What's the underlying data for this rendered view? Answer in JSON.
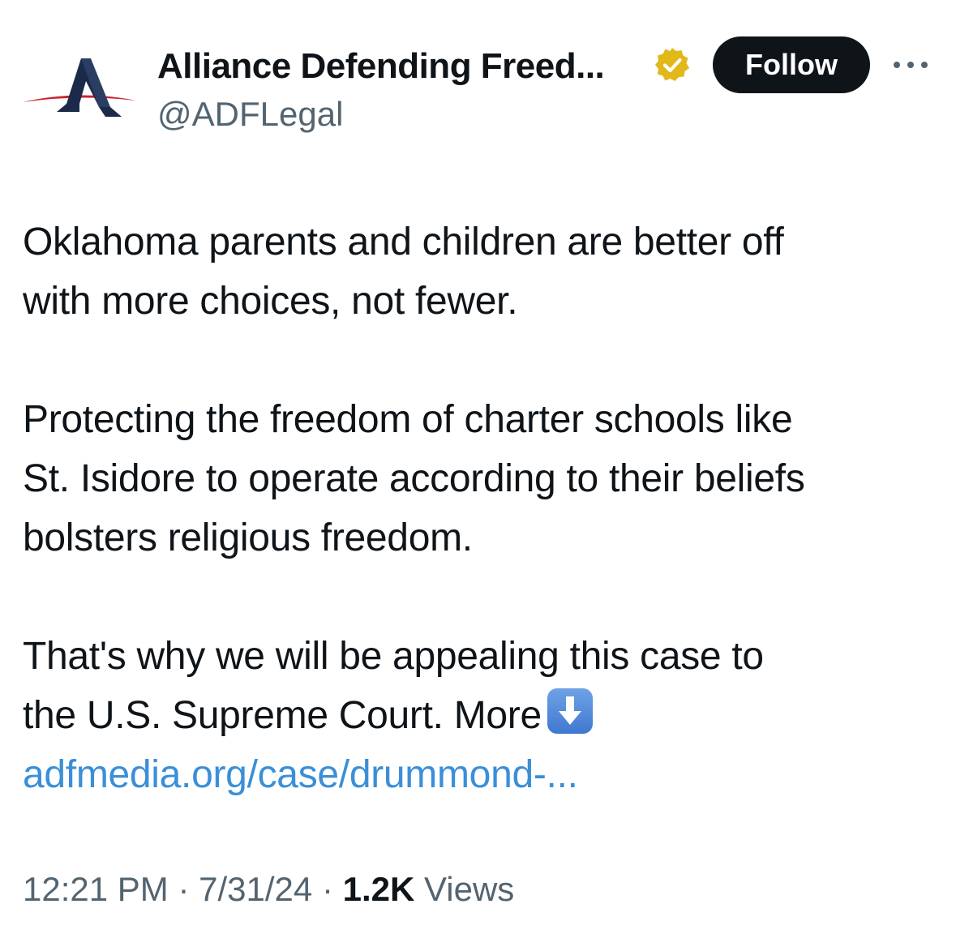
{
  "author": {
    "name": "Alliance Defending Freed...",
    "handle": "@ADFLegal",
    "avatar_icon": "adf-logo-icon",
    "verified_icon": "gold-verified-badge-icon"
  },
  "actions": {
    "follow_label": "Follow",
    "more_icon": "more-options-icon"
  },
  "tweet": {
    "paragraph_1": "Oklahoma parents and children are better off\nwith more choices, not fewer.",
    "paragraph_2": "Protecting the freedom of charter schools like\nSt. Isidore to operate according to their beliefs\nbolsters religious freedom.",
    "paragraph_3": "That's why we will be appealing this case to\nthe U.S. Supreme Court. More",
    "emoji_icon": "down-arrow-emoji-icon",
    "link_text": "adfmedia.org/case/drummond-..."
  },
  "meta": {
    "time": "12:21 PM",
    "separator": "·",
    "date": "7/31/24",
    "views_count": "1.2K",
    "views_label": "Views"
  },
  "colors": {
    "text": "#0f1419",
    "secondary": "#536471",
    "link": "#3a8fd8",
    "follow_bg": "#0f1419",
    "badge_gold": "#e2b719",
    "logo_red": "#c8232c",
    "logo_navy": "#1c2a4a"
  }
}
